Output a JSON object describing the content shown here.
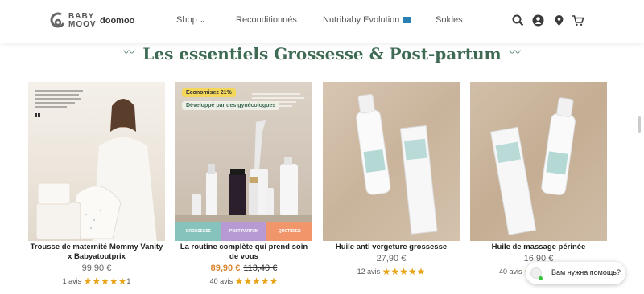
{
  "header": {
    "logo_text": "BABY\nMOOV",
    "logo_brand2": "doomoo",
    "nav": [
      {
        "label": "Shop"
      },
      {
        "label": "Reconditionnés"
      },
      {
        "label": "Nutribaby Evolution"
      },
      {
        "label": "Soldes"
      }
    ]
  },
  "section": {
    "title": "Les essentiels Grossesse & Post-partum"
  },
  "products": [
    {
      "name": "Trousse de maternité Mommy Vanity x Babyatoutprix",
      "price": "99,90 €",
      "reviews": "1 avis",
      "review_count_suffix": "1",
      "rating": 5
    },
    {
      "name": "La routine complète qui prend soin de vous",
      "sale_price": "89,90 €",
      "old_price": "113,40 €",
      "reviews": "40 avis",
      "rating": 5,
      "badge_sale": "Economisez 21%",
      "badge_dev": "Développé par des gynécologues",
      "tabs": [
        "GROSSESSE",
        "POST-PARTUM",
        "QUOTIDIEN"
      ]
    },
    {
      "name": "Huile anti vergeture grossesse",
      "price": "27,90 €",
      "reviews": "12 avis",
      "rating": 5
    },
    {
      "name": "Huile de massage périnée",
      "price": "16,90 €",
      "reviews": "40 avis",
      "rating": 5
    }
  ],
  "chat": {
    "label": "Вам нужна помощь?"
  },
  "colors": {
    "accent": "#3f6b55",
    "sale": "#d9852e",
    "stars": "#e8a317"
  }
}
